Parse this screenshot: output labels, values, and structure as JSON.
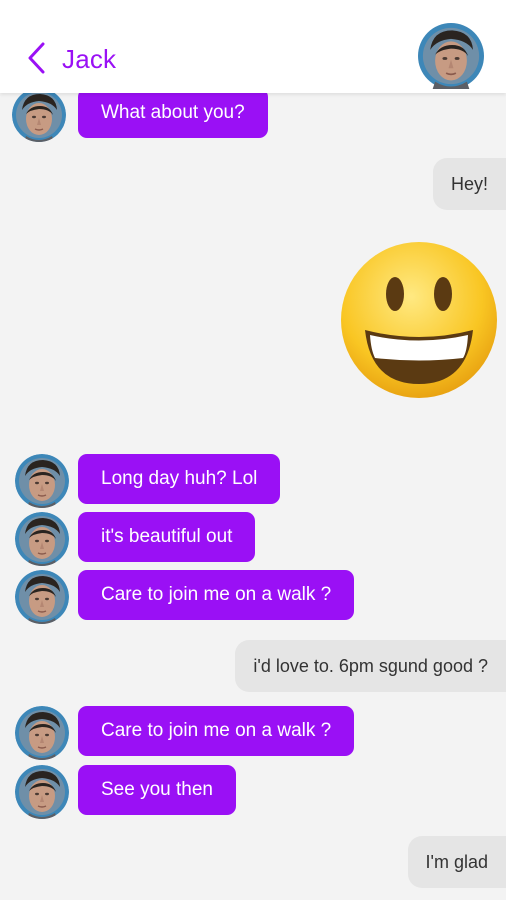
{
  "header": {
    "title": "Jack",
    "back_icon": "chevron-left-icon",
    "accent_color": "#9a10f5"
  },
  "messages": [
    {
      "direction": "incoming",
      "text": "What about you?"
    },
    {
      "direction": "outgoing",
      "text": "Hey!"
    },
    {
      "direction": "outgoing",
      "type": "emoji",
      "icon": "grinning-face-emoji"
    },
    {
      "direction": "incoming",
      "text": "Long day huh? Lol"
    },
    {
      "direction": "incoming",
      "text": "it's beautiful out"
    },
    {
      "direction": "incoming",
      "text": "Care to join me on a walk ?"
    },
    {
      "direction": "outgoing",
      "text": "i'd love to. 6pm sgund good ?"
    },
    {
      "direction": "incoming",
      "text": "Care to join me on a walk ?"
    },
    {
      "direction": "incoming",
      "text": "See you then"
    },
    {
      "direction": "outgoing",
      "text": "I'm glad"
    }
  ],
  "colors": {
    "incoming_bubble": "#9a10f5",
    "outgoing_bubble": "#e5e5e5",
    "background": "#f3f3f3"
  }
}
